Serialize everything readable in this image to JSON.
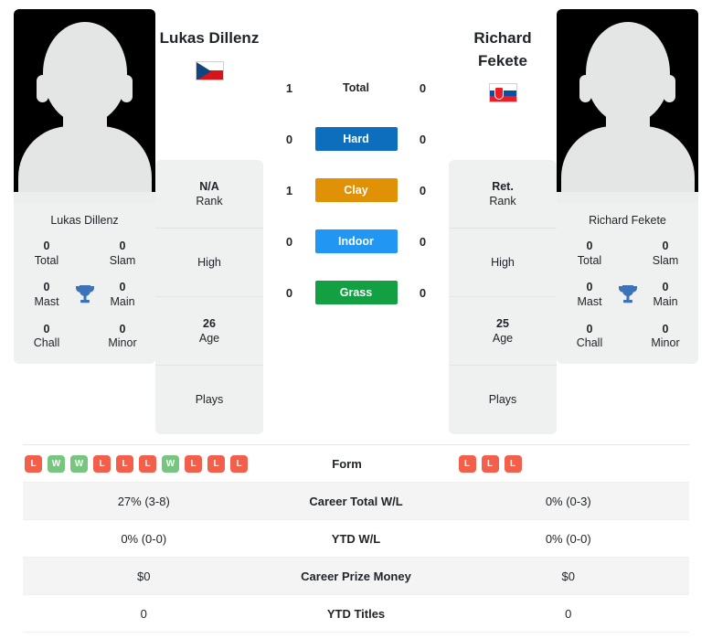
{
  "players": {
    "left": {
      "name": "Lukas Dillenz",
      "name_lines": [
        "Lukas Dillenz"
      ],
      "country_flag": "czech-republic-flag",
      "card_name": "Lukas Dillenz",
      "titles": {
        "total_value": "0",
        "total_label": "Total",
        "slam_value": "0",
        "slam_label": "Slam",
        "mast_value": "0",
        "mast_label": "Mast",
        "main_value": "0",
        "main_label": "Main",
        "chall_value": "0",
        "chall_label": "Chall",
        "minor_value": "0",
        "minor_label": "Minor"
      },
      "info": {
        "rank_value": "N/A",
        "rank_label": "Rank",
        "high_label": "High",
        "high_value": "",
        "age_value": "26",
        "age_label": "Age",
        "plays_label": "Plays",
        "plays_value": ""
      }
    },
    "right": {
      "name": "Richard Fekete",
      "name_lines": [
        "Richard",
        "Fekete"
      ],
      "country_flag": "slovakia-flag",
      "card_name": "Richard Fekete",
      "titles": {
        "total_value": "0",
        "total_label": "Total",
        "slam_value": "0",
        "slam_label": "Slam",
        "mast_value": "0",
        "mast_label": "Mast",
        "main_value": "0",
        "main_label": "Main",
        "chall_value": "0",
        "chall_label": "Chall",
        "minor_value": "0",
        "minor_label": "Minor"
      },
      "info": {
        "rank_value": "Ret.",
        "rank_label": "Rank",
        "high_label": "High",
        "high_value": "",
        "age_value": "25",
        "age_label": "Age",
        "plays_label": "Plays",
        "plays_value": ""
      }
    }
  },
  "h2h": {
    "rows": [
      {
        "label": "Total",
        "left": "1",
        "right": "0",
        "color": "",
        "text_color": "#212529",
        "plain": true
      },
      {
        "label": "Hard",
        "left": "0",
        "right": "0",
        "color": "#0d6ebd",
        "text_color": "#ffffff",
        "plain": false
      },
      {
        "label": "Clay",
        "left": "1",
        "right": "0",
        "color": "#e09106",
        "text_color": "#ffffff",
        "plain": false
      },
      {
        "label": "Indoor",
        "left": "0",
        "right": "0",
        "color": "#2196f3",
        "text_color": "#ffffff",
        "plain": false
      },
      {
        "label": "Grass",
        "left": "0",
        "right": "0",
        "color": "#12a043",
        "text_color": "#ffffff",
        "plain": false
      }
    ]
  },
  "comparison_table": {
    "rows": [
      {
        "label": "Form",
        "type": "form",
        "left_form": [
          "L",
          "W",
          "W",
          "L",
          "L",
          "L",
          "W",
          "L",
          "L",
          "L"
        ],
        "right_form": [
          "L",
          "L",
          "L"
        ],
        "striped": false
      },
      {
        "label": "Career Total W/L",
        "type": "text",
        "left": "27% (3-8)",
        "right": "0% (0-3)",
        "striped": true
      },
      {
        "label": "YTD W/L",
        "type": "text",
        "left": "0% (0-0)",
        "right": "0% (0-0)",
        "striped": false
      },
      {
        "label": "Career Prize Money",
        "type": "text",
        "left": "$0",
        "right": "$0",
        "striped": true
      },
      {
        "label": "YTD Titles",
        "type": "text",
        "left": "0",
        "right": "0",
        "striped": false
      }
    ]
  },
  "colors": {
    "hard": "#0d6ebd",
    "clay": "#e09106",
    "indoor": "#2196f3",
    "grass": "#12a043",
    "win_badge": "#78c57f",
    "loss_badge": "#f2604c",
    "trophy": "#3c72b8",
    "card_bg": "#eff0f0"
  },
  "icons": {
    "trophy": "trophy-icon",
    "flag_left": "czech-republic-flag",
    "flag_right": "slovakia-flag",
    "avatar": "player-photo-placeholder"
  }
}
